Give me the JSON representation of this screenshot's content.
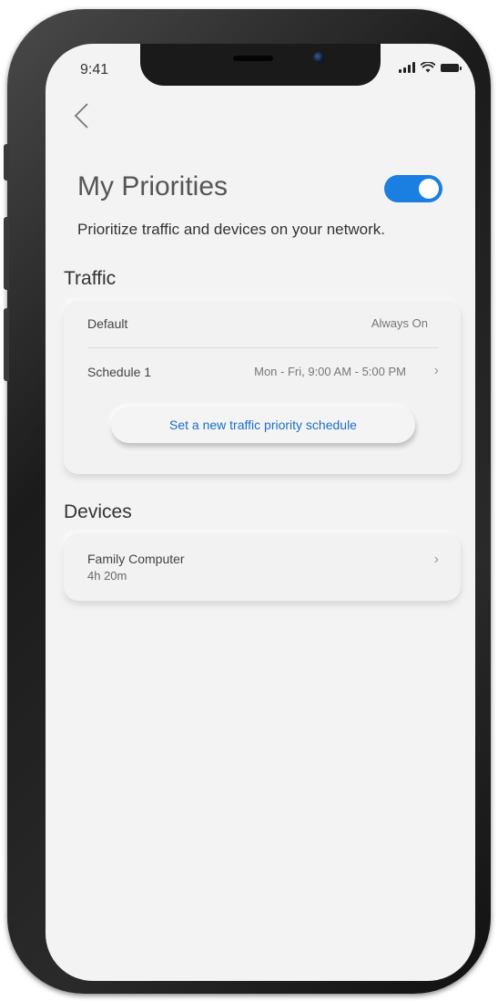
{
  "status_bar": {
    "time": "9:41"
  },
  "header": {
    "title": "My Priorities",
    "toggle_on": true,
    "subtitle": "Prioritize traffic and devices on your network."
  },
  "traffic": {
    "heading": "Traffic",
    "rows": [
      {
        "label": "Default",
        "value": "Always On"
      },
      {
        "label": "Schedule 1",
        "value": "Mon - Fri, 9:00 AM - 5:00 PM"
      }
    ],
    "button_label": "Set a new traffic priority schedule"
  },
  "devices": {
    "heading": "Devices",
    "items": [
      {
        "name": "Family Computer",
        "duration": "4h 20m"
      }
    ]
  },
  "colors": {
    "accent": "#1a7fe0",
    "link": "#1a6fc9",
    "background": "#f3f3f3"
  },
  "icons": [
    "back-chevron-icon",
    "signal-icon",
    "wifi-icon",
    "battery-icon",
    "chevron-right-icon"
  ]
}
